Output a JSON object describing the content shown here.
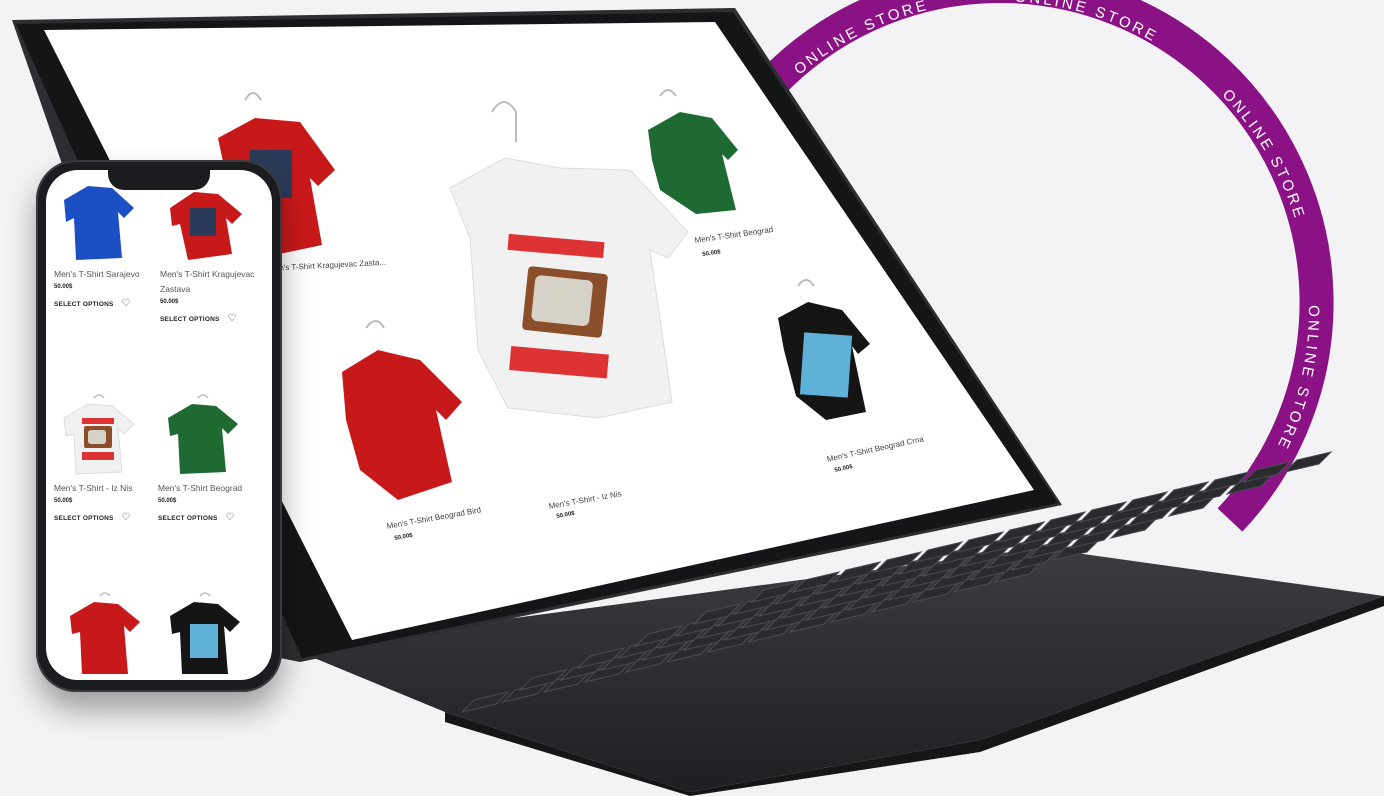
{
  "ribbon": {
    "text": "ONLINE STORE",
    "color": "#8a1285"
  },
  "tablet": {
    "products": [
      {
        "name": "Men's T-Shirt Kragujevac Zasta...",
        "price": "",
        "shirt_color": "#c8191a"
      },
      {
        "name": "Men's T-Shirt Beograd",
        "price": "50.00$",
        "shirt_color": "#1f6a32"
      },
      {
        "name": "Men's T-Shirt Beograd Bird",
        "price": "50.00$",
        "shirt_color": "#c8191a"
      },
      {
        "name": "Men's T-Shirt - Iz Nis",
        "price": "50.00$",
        "shirt_color": "#f1f1f1"
      },
      {
        "name": "Men's T-Shirt Beograd Crna",
        "price": "50.00$",
        "shirt_color": "#151515"
      }
    ]
  },
  "phone": {
    "products": [
      {
        "name": "Men's T-Shirt Sarajevo",
        "price": "50.00$",
        "action": "SELECT OPTIONS",
        "shirt_color": "#1d4fc4"
      },
      {
        "name": "Men's T-Shirt Kragujevac Zastava",
        "price": "50.00$",
        "action": "SELECT OPTIONS",
        "shirt_color": "#c8191a"
      },
      {
        "name": "Men's T-Shirt - Iz Nis",
        "price": "50.00$",
        "action": "SELECT OPTIONS",
        "shirt_color": "#f1f1f1"
      },
      {
        "name": "Men's T-Shirt Beograd",
        "price": "50.00$",
        "action": "SELECT OPTIONS",
        "shirt_color": "#1f6a32"
      },
      {
        "name": "",
        "price": "",
        "action": "",
        "shirt_color": "#c8191a"
      },
      {
        "name": "",
        "price": "",
        "action": "",
        "shirt_color": "#151515"
      }
    ]
  }
}
